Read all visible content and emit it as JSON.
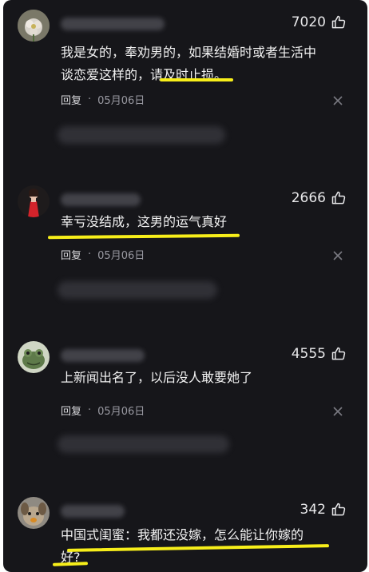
{
  "comments": [
    {
      "likes": "7020",
      "text_lines": [
        "我是女的，奉劝男的，如果结婚时或者生活中",
        "谈恋爱这样的，请及时止损。"
      ],
      "reply_label": "回复",
      "dot": "·",
      "date": "05月06日",
      "avatar": "flower-avatar"
    },
    {
      "likes": "2666",
      "text_lines": [
        "幸亏没结成，这男的运气真好"
      ],
      "reply_label": "回复",
      "dot": "·",
      "date": "05月06日",
      "avatar": "woman-red-dress-avatar"
    },
    {
      "likes": "4555",
      "text_lines": [
        "上新闻出名了，以后没人敢要她了"
      ],
      "reply_label": "回复",
      "dot": "·",
      "date": "05月06日",
      "avatar": "frog-avatar"
    },
    {
      "likes": "342",
      "text_lines": [
        "中国式闺蜜：我都还没嫁，怎么能让你嫁的",
        "好?"
      ],
      "avatar": "dog-avatar"
    }
  ],
  "icons": {
    "like": "thumbs-up-icon",
    "dismiss": "close-icon"
  },
  "colors": {
    "background": "#16161a",
    "highlight": "#f7ee1a",
    "text": "#f2f2f2",
    "meta": "#9a9aa2"
  }
}
